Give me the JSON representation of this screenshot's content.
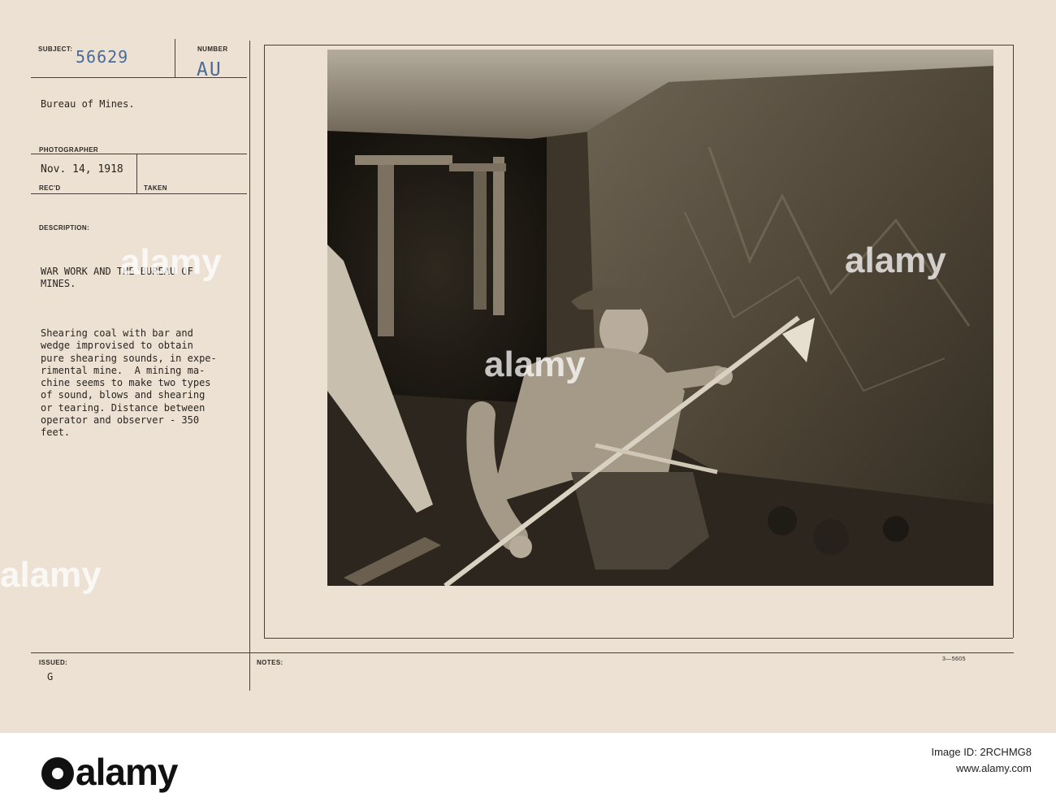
{
  "card": {
    "labels": {
      "subject": "SUBJECT:",
      "number": "NUMBER",
      "photographer": "PHOTOGRAPHER",
      "recd": "REC'D",
      "taken": "TAKEN",
      "description": "DESCRIPTION:",
      "issued": "ISSUED:",
      "notes": "NOTES:"
    },
    "subject_number": "56629",
    "number_stamp": "AU",
    "bureau": "Bureau of Mines.",
    "date": "Nov. 14, 1918",
    "heading_lines": [
      "WAR WORK AND THE BUREAU OF",
      "MINES."
    ],
    "body_lines": [
      "Shearing coal with bar and",
      "wedge improvised to obtain",
      "pure shearing sounds, in expe-",
      "rimental mine.  A mining ma-",
      "chine seems to make two types",
      "of sound, blows and shearing",
      "or tearing. Distance between",
      "operator and observer - 350",
      "feet."
    ],
    "issued_value": "G",
    "form_code": "3—5605"
  },
  "watermark_text": "alamy",
  "footer": {
    "logo_text": "alamy",
    "image_id_line": "Image ID: 2RCHMG8",
    "site": "www.alamy.com"
  },
  "colors": {
    "card_paper": "#ece1d3",
    "stamp_blue": "#4a6b96",
    "ink": "#2a2420"
  }
}
